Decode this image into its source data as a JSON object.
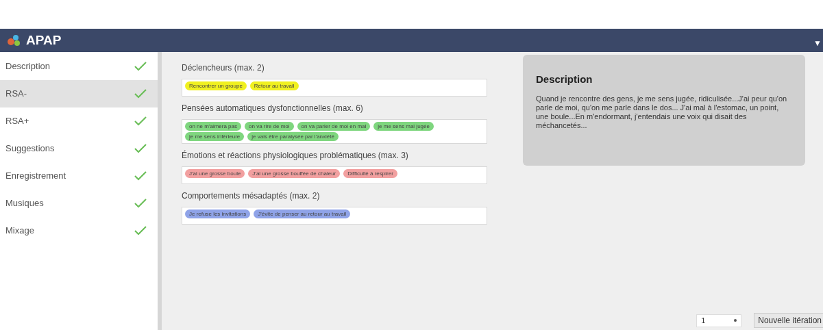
{
  "header": {
    "title": "APAP",
    "menu_caret": "▼"
  },
  "sidebar": {
    "items": [
      {
        "label": "Description",
        "selected": false,
        "checked": true
      },
      {
        "label": "RSA-",
        "selected": true,
        "checked": true
      },
      {
        "label": "RSA+",
        "selected": false,
        "checked": true
      },
      {
        "label": "Suggestions",
        "selected": false,
        "checked": true
      },
      {
        "label": "Enregistrement",
        "selected": false,
        "checked": true
      },
      {
        "label": "Musiques",
        "selected": false,
        "checked": true
      },
      {
        "label": "Mixage",
        "selected": false,
        "checked": true
      }
    ]
  },
  "groups": [
    {
      "title": "Déclencheurs (max. 2)",
      "color": "#f0f020",
      "tags": [
        "Rencontrer un groupe",
        "Retour au travail"
      ]
    },
    {
      "title": "Pensées automatiques dysfonctionnelles (max. 6)",
      "color": "#7fd67f",
      "tags": [
        "on ne m'aimera pas",
        "on va rire de moi",
        "on va parler de moi en mal",
        "je me sens mal jugée",
        "je me sens inférieure",
        "je vais être paralysée par l'anxiété"
      ]
    },
    {
      "title": "Émotions et réactions physiologiques problématiques (max. 3)",
      "color": "#f2a0a0",
      "tags": [
        "J'ai une grosse boule",
        "J'ai une grosse bouffée de chaleur",
        "Difficulté à respirer"
      ]
    },
    {
      "title": "Comportements mésadaptés (max. 2)",
      "color": "#8fa3e8",
      "tags": [
        "Je refuse les invitations",
        "J'évite de penser au retour au travail"
      ]
    }
  ],
  "description": {
    "title": "Description",
    "text": "Quand je rencontre des gens, je me sens jugée, ridiculisée...J'ai peur qu'on parle de moi, qu'on me parle dans le dos... J'ai mal à l'estomac, un point, une boule...En m'endormant, j'entendais une voix qui disait des méchancetés..."
  },
  "footer": {
    "iteration_select": "1",
    "new_iteration_button": "Nouvelle itération"
  }
}
